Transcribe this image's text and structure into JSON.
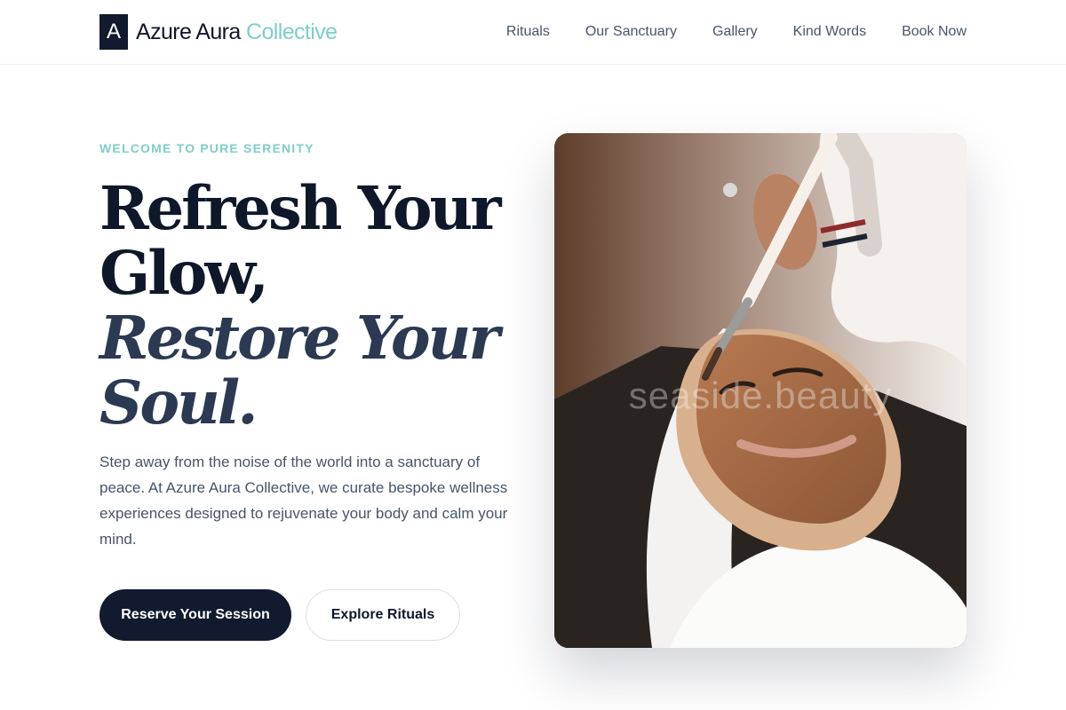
{
  "header": {
    "logo_mark": "A",
    "logo_name": "Azure Aura",
    "logo_accent": "Collective",
    "nav": [
      "Rituals",
      "Our Sanctuary",
      "Gallery",
      "Kind Words",
      "Book Now"
    ]
  },
  "hero": {
    "eyebrow": "WELCOME TO PURE SERENITY",
    "headline_line1": "Refresh Your Glow,",
    "headline_line2": "Restore Your Soul.",
    "intro": "Step away from the noise of the world into a sanctuary of peace. At Azure Aura Collective, we curate bespoke wellness experiences designed to rejuvenate your body and calm your mind.",
    "primary_button": "Reserve Your Session",
    "secondary_button": "Explore Rituals",
    "image_watermark": "seaside.beauty"
  },
  "colors": {
    "navy": "#111a2e",
    "teal_accent": "#7ecfc7",
    "slate_text": "#475569"
  },
  "icons": {
    "logo_mark": "letter-a-square"
  }
}
